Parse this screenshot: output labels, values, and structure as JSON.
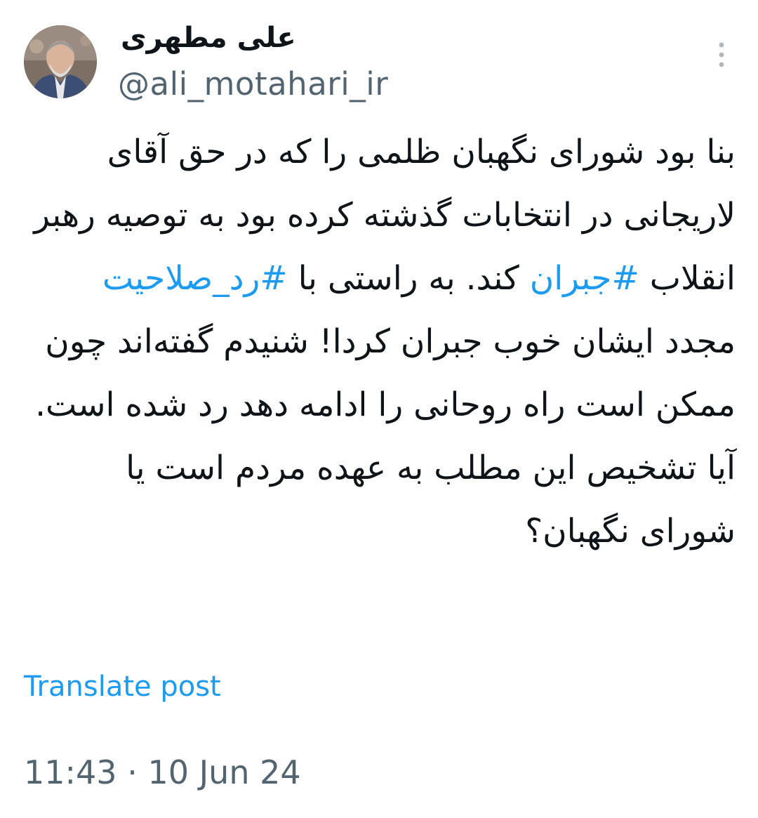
{
  "author": {
    "display_name": "علی مطهری",
    "handle": "@ali_motahari_ir",
    "avatar_icon": "profile-photo"
  },
  "more_icon": "more-vertical-icon",
  "tweet": {
    "part1": "بنا بود شورای نگهبان ظلمی را که در حق آقای لاریجانی در انتخابات گذشته کرده بود به توصیه رهبر انقلاب ",
    "hashtag1": "#جبران",
    "part2": " کند. به راستی با ",
    "hashtag2": "#رد_صلاحیت",
    "part3": " مجدد ایشان خوب جبران کردا! شنیدم گفته‌اند چون ممکن است راه روحانی را ادامه دهد رد شده است. آیا تشخیص این مطلب به عهده مردم است یا شورای نگهبان؟"
  },
  "translate_label": "Translate post",
  "time": "11:43",
  "separator": " · ",
  "date": "10 Jun 24",
  "colors": {
    "text": "#0f1419",
    "secondary": "#536471",
    "link": "#1d9bf0"
  }
}
